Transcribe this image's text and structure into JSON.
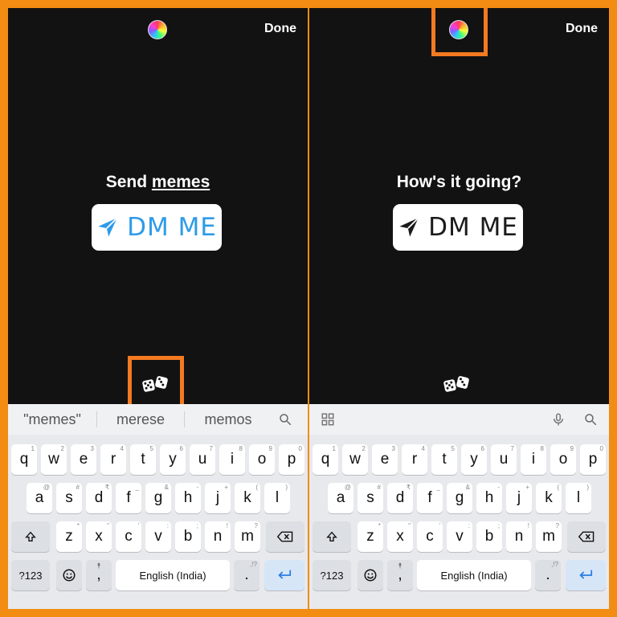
{
  "colors": {
    "highlight": "#f47a20",
    "left_dm": "#2e9be8",
    "right_dm": "#1b1b1b",
    "background": "#121212"
  },
  "panels": [
    {
      "id": "left",
      "done_label": "Done",
      "headline_prefix": "Send ",
      "headline_emphasis": "memes",
      "sticker_label": "DM ME",
      "suggestions": [
        "\"memes\"",
        "merese",
        "memos"
      ]
    },
    {
      "id": "right",
      "done_label": "Done",
      "headline_prefix": "How's it going?",
      "headline_emphasis": "",
      "sticker_label": "DM ME"
    }
  ],
  "keyboard": {
    "row1": [
      "q",
      "w",
      "e",
      "r",
      "t",
      "y",
      "u",
      "i",
      "o",
      "p"
    ],
    "row1_hints": [
      "1",
      "2",
      "3",
      "4",
      "5",
      "6",
      "7",
      "8",
      "9",
      "0"
    ],
    "row2": [
      "a",
      "s",
      "d",
      "f",
      "g",
      "h",
      "j",
      "k",
      "l"
    ],
    "row2_hints": [
      "@",
      "#",
      "₹",
      "_",
      "&",
      "-",
      "+",
      "(",
      ")"
    ],
    "row3": [
      "z",
      "x",
      "c",
      "v",
      "b",
      "n",
      "m"
    ],
    "row3_hints": [
      "*",
      "\"",
      "'",
      ":",
      ";",
      "!",
      "?"
    ],
    "mode_label": "?123",
    "space_label": "English (India)",
    "comma": ",",
    "period": ".",
    "period_hint": ",!?"
  }
}
